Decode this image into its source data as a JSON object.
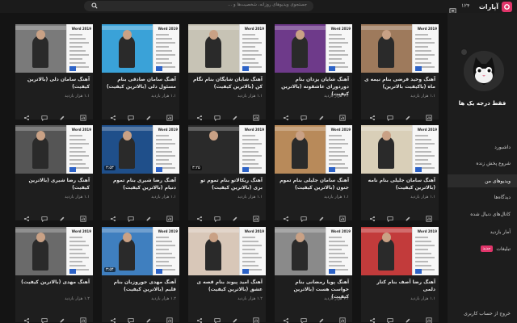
{
  "app": {
    "logo_text": "آپارات",
    "brand_color": "#e0356a"
  },
  "topbar": {
    "counter": "۱۲۴",
    "search_placeholder": "جستجوی ویدیوهای روزانه، شخصیت‌ها و ...",
    "search_icon": "search-icon"
  },
  "sidebar": {
    "channel_name": "فقط درجه یک ها",
    "items": [
      {
        "label": "داشبورد",
        "active": false
      },
      {
        "label": "شروع پخش زنده",
        "active": false
      },
      {
        "label": "ویدیوهای من",
        "active": true
      },
      {
        "label": "دیدگاه‌ها",
        "active": false
      },
      {
        "label": "کانال‌های دنبال شده",
        "active": false
      },
      {
        "label": "آمار بازدید",
        "active": false
      },
      {
        "label": "تبلیغات",
        "active": false,
        "badge": "جدید"
      }
    ],
    "logout": "خروج از حساب کاربری"
  },
  "doc_label": "Word 2019",
  "videos": [
    {
      "title": "آهنگ وحید فرضی بنام نیمه ی ماه (باکیفیت بالاترین)",
      "views": "۱.۱ هزار بازدید",
      "duration": "",
      "poster": "#9e7a5c"
    },
    {
      "title": "آهنگ شایان یزدان بنام دوردورای عاشقونه (بالاترین کیفیت)",
      "views": "۱.۱ هزار بازدید",
      "duration": "",
      "poster": "#6e3a8a"
    },
    {
      "title": "آهنگ شایان شایگان بنام نگام کن (بالاترین کیفیت)",
      "views": "۱.۱ هزار بازدید",
      "duration": "",
      "poster": "#c7c3b5"
    },
    {
      "title": "آهنگ سامان صادقی بنام مسئول دلی (بالاترین کیفیت)",
      "views": "۱.۱ هزار بازدید",
      "duration": "",
      "poster": "#3aa2d8"
    },
    {
      "title": "آهنگ سامان دلی (بالاترین کیفیت)",
      "views": "۱.۱ هزار بازدید",
      "duration": "",
      "poster": "#7a7a7a"
    },
    {
      "title": "آهنگ سامان جلیلی بنام نامه (بالاترین کیفیت)",
      "views": "۱.۱ هزار بازدید",
      "duration": "",
      "poster": "#d9cfb8"
    },
    {
      "title": "آهنگ سامان جلیلی بنام تموم جنون (بالاترین کیفیت)",
      "views": "۱.۱ هزار بازدید",
      "duration": "",
      "poster": "#b88a5a"
    },
    {
      "title": "آهنگ ریکالاتو بنام تموم تو بری (بالاترین کیفیت)",
      "views": "۱.۱ هزار بازدید",
      "duration": "۳:۲۵",
      "poster": "#2a2a2a"
    },
    {
      "title": "آهنگ رضا شیری بنام تموم دنیام (بالاترین کیفیت)",
      "views": "۱.۱ هزار بازدید",
      "duration": "۳:۵۳",
      "poster": "#1f4f8a"
    },
    {
      "title": "آهنگ رضا شیری (بالاترین کیفیت)",
      "views": "۱.۱ هزار بازدید",
      "duration": "",
      "poster": "#555555"
    },
    {
      "title": "آهنگ رضا آصف بنام کنار دلمی",
      "views": "۱.۱ هزار بازدید",
      "duration": "",
      "poster": "#c23b3b"
    },
    {
      "title": "آهنگ پویا رمضانی بنام حواست هست (بالاترین کیفیت)",
      "views": "۱.۲ هزار بازدید",
      "duration": "",
      "poster": "#8a8a8a"
    },
    {
      "title": "آهنگ امید پیوند بنام قصه ی عشق (بالاترین کیفیت)",
      "views": "۱.۲ هزار بازدید",
      "duration": "",
      "poster": "#d8c7b8"
    },
    {
      "title": "آهنگ مهدی جوروزبان بنام قلبم (بالاترین کیفیت)",
      "views": "۱.۲ هزار بازدید",
      "duration": "۳:۵۴",
      "poster": "#3f7fbf"
    },
    {
      "title": "آهنگ مهدی (بالاترین کیفیت)",
      "views": "۱.۲ هزار بازدید",
      "duration": "",
      "poster": "#6a6a6a"
    }
  ]
}
